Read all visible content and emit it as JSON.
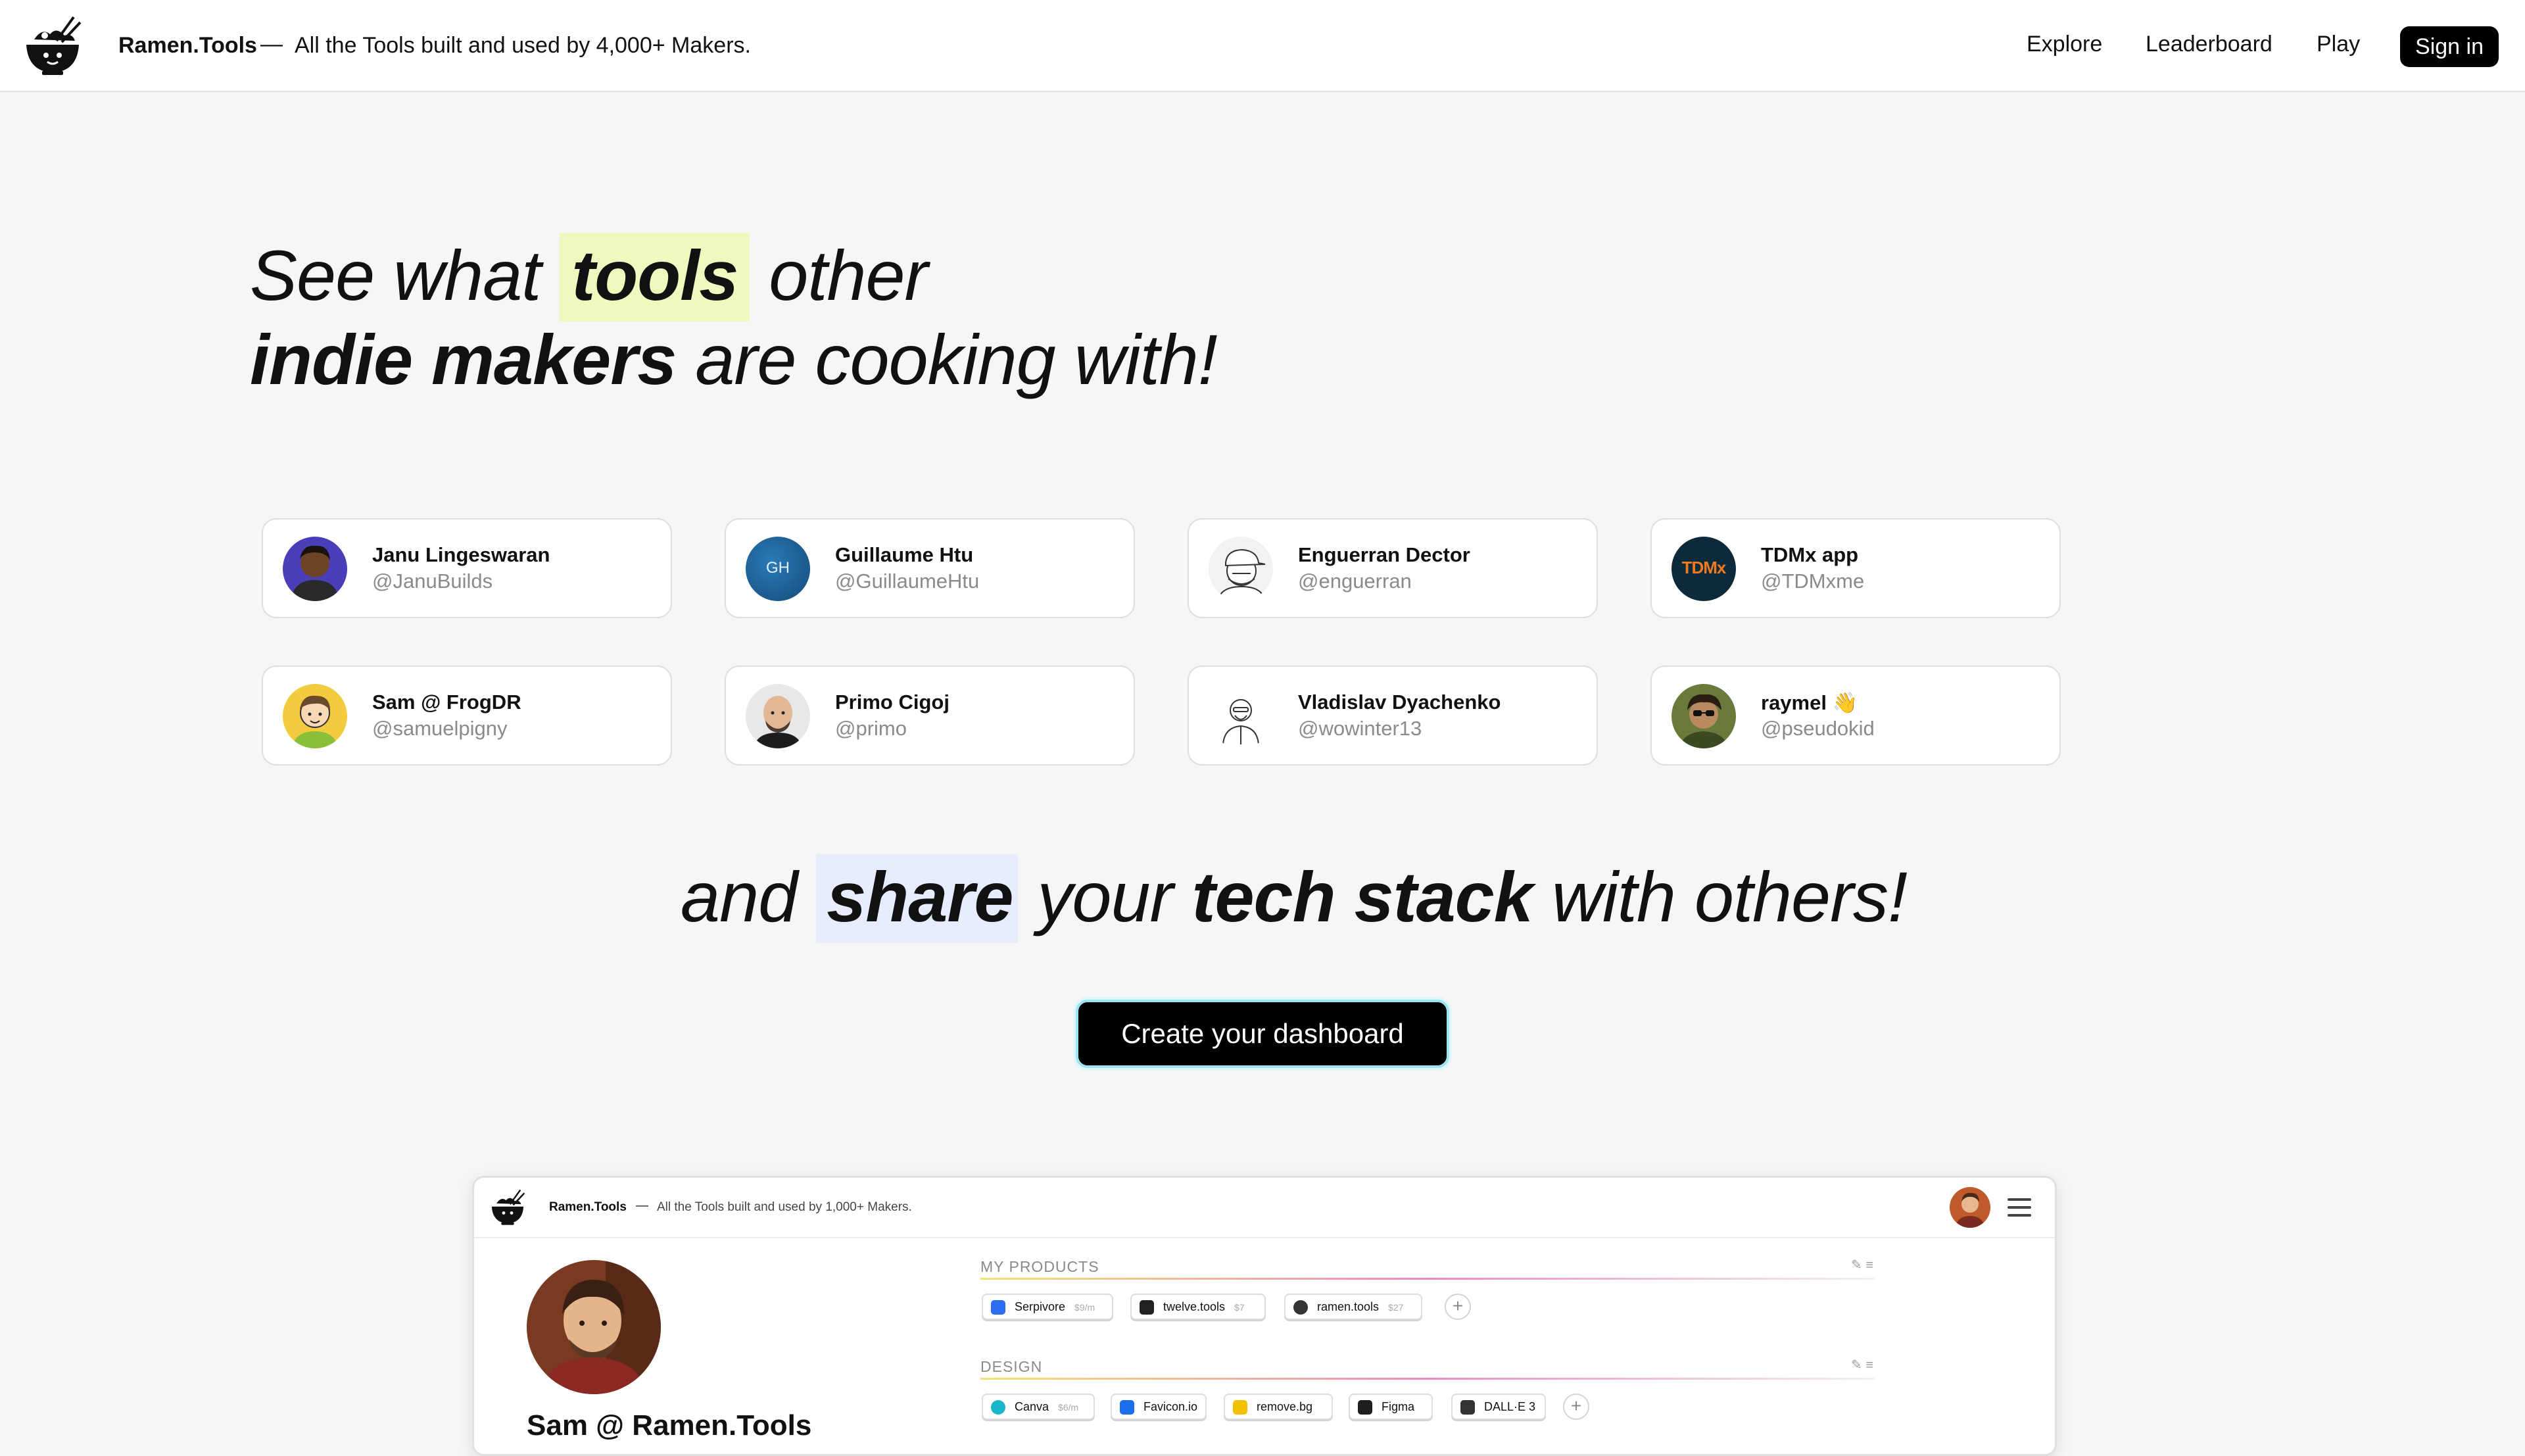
{
  "header": {
    "brand": "Ramen.Tools",
    "dash": "—",
    "tagline": "All the Tools built and used by 4,000+ Makers.",
    "nav": [
      "Explore",
      "Leaderboard",
      "Play"
    ],
    "signin": "Sign in"
  },
  "hero": {
    "line1_pre": "See what ",
    "line1_highlight": "tools",
    "line1_post": " other",
    "line2_bold": "indie makers",
    "line2_post": " are cooking with!"
  },
  "makers": [
    {
      "name": "Janu Lingeswaran",
      "handle": "@JanuBuilds",
      "avatar": "portrait-dark"
    },
    {
      "name": "Guillaume Htu",
      "handle": "@GuillaumeHtu",
      "avatar": "initials-GH",
      "initials": "GH"
    },
    {
      "name": "Enguerran Dector",
      "handle": "@enguerran",
      "avatar": "sketch-cap"
    },
    {
      "name": "TDMx app",
      "handle": "@TDMxme",
      "avatar": "tdmx-logo",
      "initials": "TDMx"
    },
    {
      "name": "Sam @ FrogDR",
      "handle": "@samuelpigny",
      "avatar": "cartoon-yellow"
    },
    {
      "name": "Primo Cigoj",
      "handle": "@primo",
      "avatar": "portrait-bald"
    },
    {
      "name": "Vladislav Dyachenko",
      "handle": "@wowinter13",
      "avatar": "sketch-line"
    },
    {
      "name": "raymel 👋",
      "handle": "@pseudokid",
      "avatar": "cartoon-glasses"
    }
  ],
  "share": {
    "pre": "and ",
    "highlight": "share",
    "mid": " your ",
    "bold": "tech stack",
    "post": " with others!"
  },
  "cta": "Create your dashboard",
  "preview": {
    "brand": "Ramen.Tools",
    "dash": "—",
    "tagline": "All the Tools built and used by 1,000+ Makers.",
    "profile_name": "Sam @ Ramen.Tools",
    "sections": [
      {
        "title": "MY PRODUCTS",
        "items": [
          {
            "label": "Serpivore",
            "price": "$9/m",
            "color": "#2b6cf0"
          },
          {
            "label": "twelve.tools",
            "price": "$7",
            "color": "#222222"
          },
          {
            "label": "ramen.tools",
            "price": "$27",
            "color": "#333333"
          }
        ]
      },
      {
        "title": "DESIGN",
        "items": [
          {
            "label": "Canva",
            "price": "$6/m",
            "color": "#19b5c8"
          },
          {
            "label": "Favicon.io",
            "price": "",
            "color": "#1e6ef0"
          },
          {
            "label": "remove.bg",
            "price": "",
            "color": "#f2c200"
          },
          {
            "label": "Figma",
            "price": "",
            "color": "#1e1e1e"
          },
          {
            "label": "DALL·E 3",
            "price": "",
            "color": "#333333"
          }
        ]
      }
    ]
  },
  "colors": {
    "tools_highlight": "#f0f8c0",
    "share_highlight": "#e8ecff",
    "cta_glow": "#9ee3f0",
    "page_bg": "#f6f6f6"
  }
}
